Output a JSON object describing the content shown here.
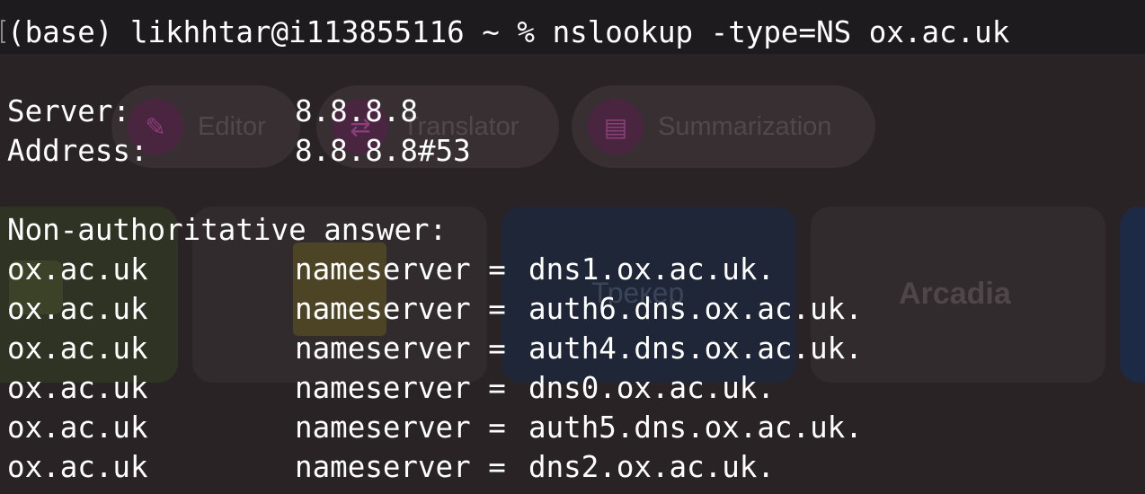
{
  "terminal": {
    "prompt": "(base) likhhtar@i113855116 ~ % nslookup -type=NS ox.ac.uk",
    "server_label": "Server:",
    "server_value": "8.8.8.8",
    "address_label": "Address:",
    "address_value": "8.8.8.8#53",
    "answer_heading": "Non-authoritative answer:",
    "records": [
      {
        "domain": "ox.ac.uk",
        "type_label": "nameserver =",
        "value": "dns1.ox.ac.uk."
      },
      {
        "domain": "ox.ac.uk",
        "type_label": "nameserver =",
        "value": "auth6.dns.ox.ac.uk."
      },
      {
        "domain": "ox.ac.uk",
        "type_label": "nameserver =",
        "value": "auth4.dns.ox.ac.uk."
      },
      {
        "domain": "ox.ac.uk",
        "type_label": "nameserver =",
        "value": "dns0.ox.ac.uk."
      },
      {
        "domain": "ox.ac.uk",
        "type_label": "nameserver =",
        "value": "auth5.dns.ox.ac.uk."
      },
      {
        "domain": "ox.ac.uk",
        "type_label": "nameserver =",
        "value": "dns2.ox.ac.uk."
      }
    ]
  },
  "background": {
    "pills": [
      {
        "label": "Editor",
        "icon": "edit-icon"
      },
      {
        "label": "Translator",
        "icon": "translate-icon"
      },
      {
        "label": "Summarization",
        "icon": "summary-icon"
      }
    ],
    "tiles": [
      {
        "label": "Трекер"
      },
      {
        "label": "Arcadia"
      }
    ]
  },
  "colors": {
    "terminal_text": "#ffffff",
    "background": "#241f24",
    "accent_icon": "#8a3f7a"
  }
}
